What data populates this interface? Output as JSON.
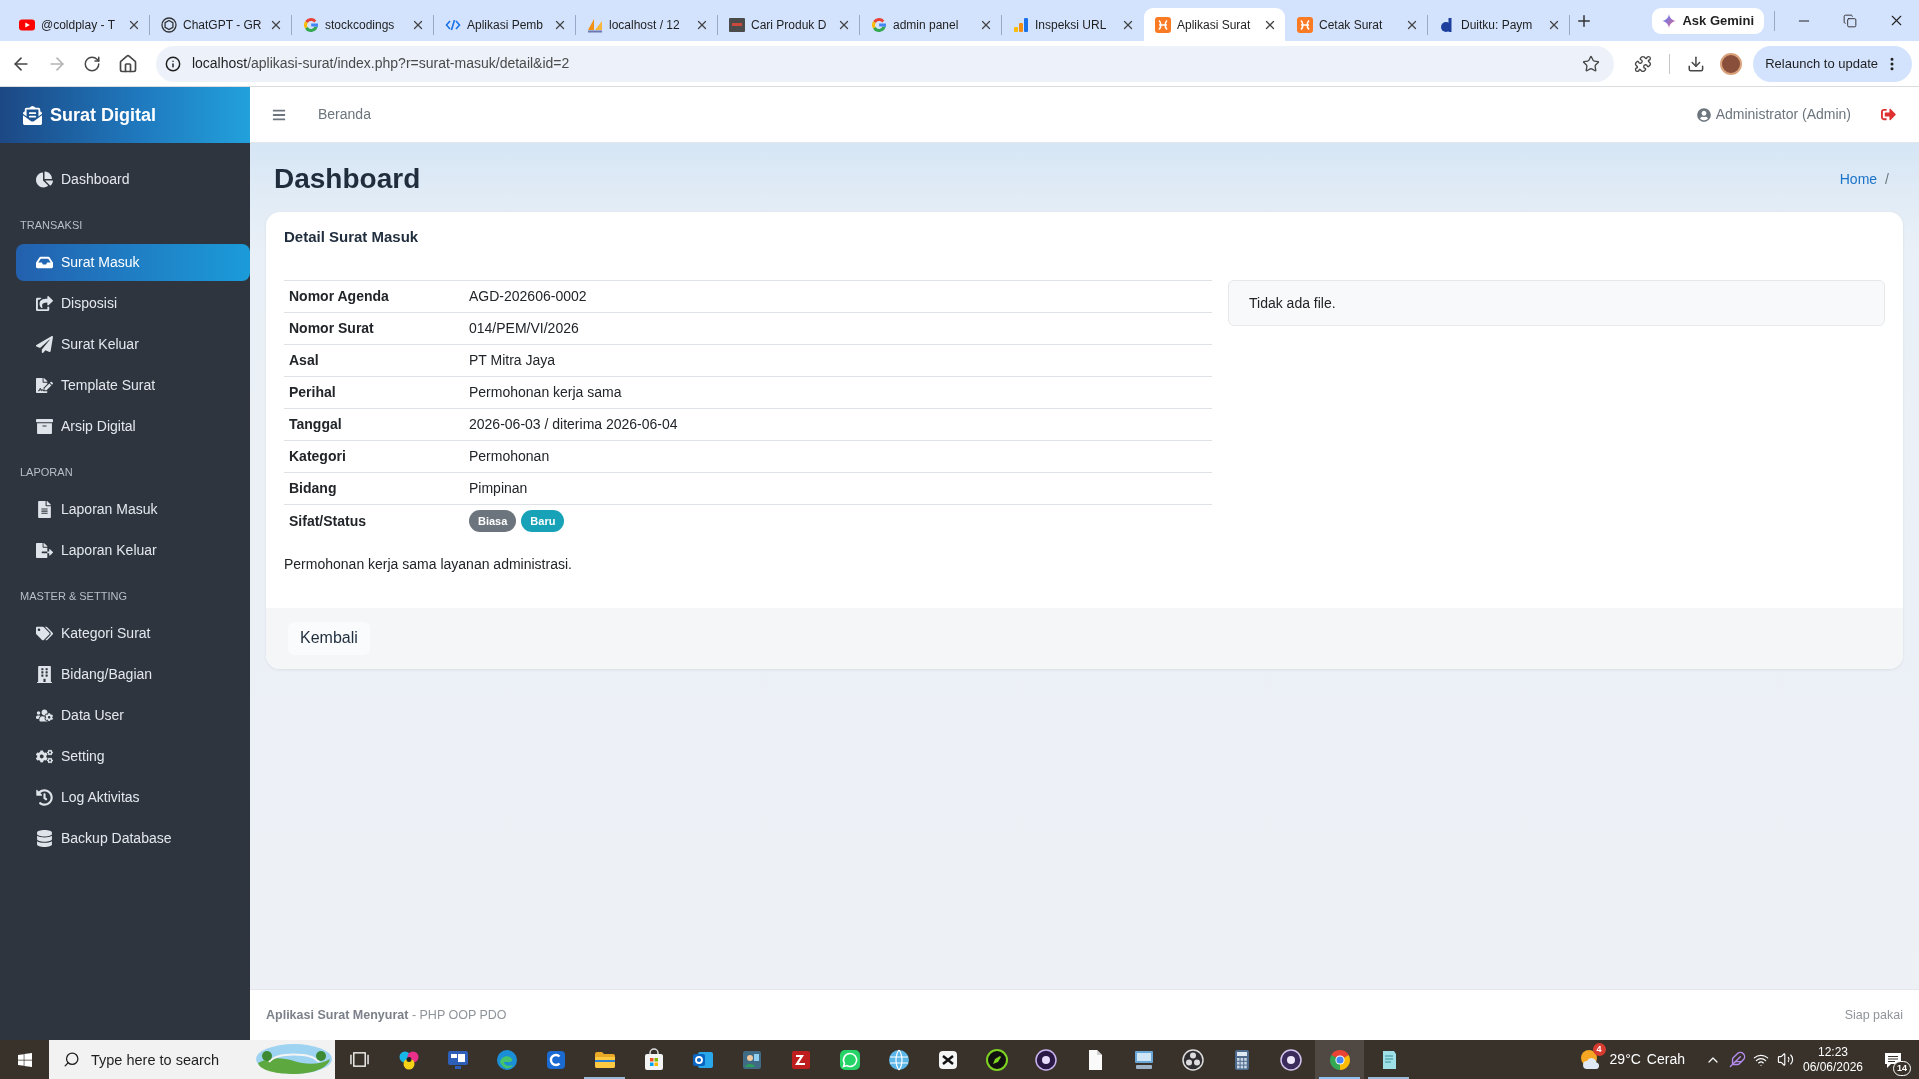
{
  "browser": {
    "tabs": [
      {
        "title": "@coldplay - T",
        "selected": false
      },
      {
        "title": "ChatGPT - GR",
        "selected": false
      },
      {
        "title": "stockcodings",
        "selected": false
      },
      {
        "title": "Aplikasi Pemb",
        "selected": false
      },
      {
        "title": "localhost / 12",
        "selected": false
      },
      {
        "title": "Cari Produk D",
        "selected": false
      },
      {
        "title": "admin panel",
        "selected": false
      },
      {
        "title": "Inspeksi URL",
        "selected": false
      },
      {
        "title": "Aplikasi Surat",
        "selected": true
      },
      {
        "title": "Cetak Surat",
        "selected": false
      },
      {
        "title": "Duitku: Paym",
        "selected": false
      }
    ],
    "gemini_button": "Ask Gemini",
    "address": {
      "host": "localhost",
      "path": "/aplikasi-surat/index.php?r=surat-masuk/detail&id=2"
    },
    "relaunch_button": "Relaunch to update"
  },
  "sidebar": {
    "brand": "Surat Digital",
    "sections": [
      {
        "items": [
          {
            "label": "Dashboard",
            "selected": false
          }
        ]
      },
      {
        "heading": "TRANSAKSI",
        "items": [
          {
            "label": "Surat Masuk",
            "selected": true
          },
          {
            "label": "Disposisi",
            "selected": false
          },
          {
            "label": "Surat Keluar",
            "selected": false
          },
          {
            "label": "Template Surat",
            "selected": false
          },
          {
            "label": "Arsip Digital",
            "selected": false
          }
        ]
      },
      {
        "heading": "LAPORAN",
        "items": [
          {
            "label": "Laporan Masuk",
            "selected": false
          },
          {
            "label": "Laporan Keluar",
            "selected": false
          }
        ]
      },
      {
        "heading": "MASTER & SETTING",
        "items": [
          {
            "label": "Kategori Surat",
            "selected": false
          },
          {
            "label": "Bidang/Bagian",
            "selected": false
          },
          {
            "label": "Data User",
            "selected": false
          },
          {
            "label": "Setting",
            "selected": false
          },
          {
            "label": "Log Aktivitas",
            "selected": false
          },
          {
            "label": "Backup Database",
            "selected": false
          }
        ]
      }
    ]
  },
  "topbar": {
    "link": "Beranda",
    "user": "Administrator (Admin)"
  },
  "page_header": {
    "title": "Dashboard",
    "breadcrumb": {
      "link": "Home",
      "separator": "/"
    }
  },
  "detail_card": {
    "title": "Detail Surat Masuk",
    "details": [
      {
        "kind": "text",
        "label": "Nomor Agenda",
        "value": "AGD-202606-0002"
      },
      {
        "kind": "text",
        "label": "Nomor Surat",
        "value": "014/PEM/VI/2026"
      },
      {
        "kind": "text",
        "label": "Asal",
        "value": "PT Mitra Jaya"
      },
      {
        "kind": "text",
        "label": "Perihal",
        "value": "Permohonan kerja sama"
      },
      {
        "kind": "text",
        "label": "Tanggal",
        "value": "2026-06-03 / diterima 2026-06-04"
      },
      {
        "kind": "text",
        "label": "Kategori",
        "value": "Permohonan"
      },
      {
        "kind": "text",
        "label": "Bidang",
        "value": "Pimpinan"
      },
      {
        "kind": "badges",
        "label": "Sifat/Status",
        "badges": [
          {
            "text": "Biasa",
            "color": "#6c757d"
          },
          {
            "text": "Baru",
            "color": "#17a2b8"
          }
        ]
      }
    ],
    "file_notice": "Tidak ada file.",
    "description": "Permohonan kerja sama layanan administrasi.",
    "back_button": "Kembali"
  },
  "footer": {
    "credit": "**Aplikasi Surat Menyurat** - PHP OOP PDO",
    "status": "Siap pakai"
  },
  "taskbar": {
    "search_placeholder": "Type here to search",
    "apps": [
      {
        "running": false,
        "selected": false
      },
      {
        "running": false,
        "selected": false
      },
      {
        "running": false,
        "selected": false
      },
      {
        "running": false,
        "selected": false
      },
      {
        "running": true,
        "selected": false
      },
      {
        "running": false,
        "selected": false
      },
      {
        "running": false,
        "selected": false
      },
      {
        "running": false,
        "selected": false
      },
      {
        "running": false,
        "selected": false
      },
      {
        "running": false,
        "selected": false
      },
      {
        "running": false,
        "selected": false
      },
      {
        "running": false,
        "selected": false
      },
      {
        "running": false,
        "selected": false
      },
      {
        "running": false,
        "selected": false
      },
      {
        "running": false,
        "selected": false
      },
      {
        "running": false,
        "selected": false
      },
      {
        "running": false,
        "selected": false
      },
      {
        "running": false,
        "selected": false
      },
      {
        "running": false,
        "selected": false
      },
      {
        "running": true,
        "selected": true
      },
      {
        "running": true,
        "selected": false
      }
    ],
    "weather": {
      "badge": "4",
      "temperature": "29°C",
      "condition": "Cerah"
    },
    "time": "12:23",
    "date": "06/06/2026",
    "notification_count": "14"
  }
}
